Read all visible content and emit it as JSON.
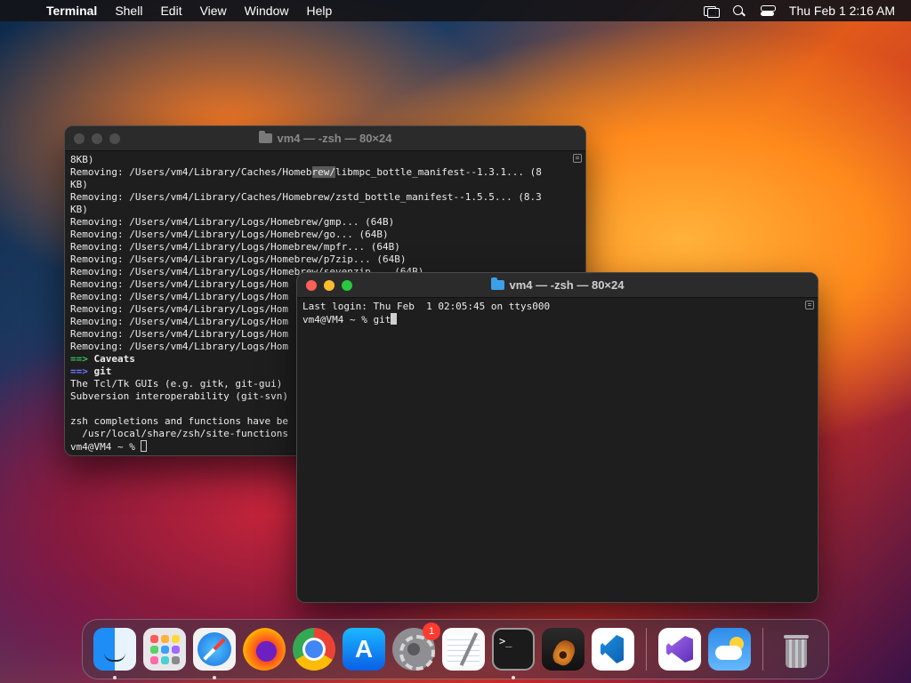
{
  "menubar": {
    "app_name": "Terminal",
    "menus": [
      "Shell",
      "Edit",
      "View",
      "Window",
      "Help"
    ],
    "clock": "Thu Feb 1  2:16 AM",
    "status_icons": [
      "screen-mirroring-icon",
      "spotlight-search-icon",
      "control-center-icon"
    ]
  },
  "back_window": {
    "title": "vm4 — -zsh — 80×24",
    "lines": [
      "8KB)",
      "Removing: /Users/vm4/Library/Caches/Homebrew/libmpc_bottle_manifest--1.3.1... (8",
      "KB)",
      "Removing: /Users/vm4/Library/Caches/Homebrew/zstd_bottle_manifest--1.5.5... (8.3",
      "KB)",
      "Removing: /Users/vm4/Library/Logs/Homebrew/gmp... (64B)",
      "Removing: /Users/vm4/Library/Logs/Homebrew/go... (64B)",
      "Removing: /Users/vm4/Library/Logs/Homebrew/mpfr... (64B)",
      "Removing: /Users/vm4/Library/Logs/Homebrew/p7zip... (64B)",
      "Removing: /Users/vm4/Library/Logs/Homebrew/sevenzip... (64B)",
      "Removing: /Users/vm4/Library/Logs/Hom",
      "Removing: /Users/vm4/Library/Logs/Hom",
      "Removing: /Users/vm4/Library/Logs/Hom",
      "Removing: /Users/vm4/Library/Logs/Hom",
      "Removing: /Users/vm4/Library/Logs/Hom",
      "Removing: /Users/vm4/Library/Logs/Hom",
      "==> Caveats",
      "==> git",
      "The Tcl/Tk GUIs (e.g. gitk, git-gui)",
      "Subversion interoperability (git-svn)",
      "",
      "zsh completions and functions have be",
      "  /usr/local/share/zsh/site-functions",
      "vm4@VM4 ~ % "
    ]
  },
  "front_window": {
    "title": "vm4 — -zsh — 80×24",
    "lines": [
      "Last login: Thu Feb  1 02:05:45 on ttys000",
      "vm4@VM4 ~ % git"
    ]
  },
  "dock": {
    "apps": [
      {
        "name": "Finder",
        "icon": "finder-icon",
        "running": true
      },
      {
        "name": "Launchpad",
        "icon": "launchpad-icon",
        "running": false
      },
      {
        "name": "Safari",
        "icon": "safari-icon",
        "running": true
      },
      {
        "name": "Firefox",
        "icon": "firefox-icon",
        "running": false
      },
      {
        "name": "Google Chrome",
        "icon": "chrome-icon",
        "running": false
      },
      {
        "name": "App Store",
        "icon": "app-store-icon",
        "running": false
      },
      {
        "name": "System Settings",
        "icon": "system-settings-icon",
        "running": false,
        "badge": "1"
      },
      {
        "name": "TextEdit",
        "icon": "textedit-icon",
        "running": false
      },
      {
        "name": "Terminal",
        "icon": "terminal-icon",
        "running": true
      },
      {
        "name": "GarageBand",
        "icon": "garageband-icon",
        "running": false
      },
      {
        "name": "Visual Studio Code",
        "icon": "vscode-icon",
        "running": false
      },
      {
        "name": "Visual Studio",
        "icon": "visual-studio-icon",
        "running": false
      },
      {
        "name": "Weather",
        "icon": "weather-icon",
        "running": false
      },
      {
        "name": "Trash",
        "icon": "trash-icon",
        "running": false
      }
    ]
  }
}
